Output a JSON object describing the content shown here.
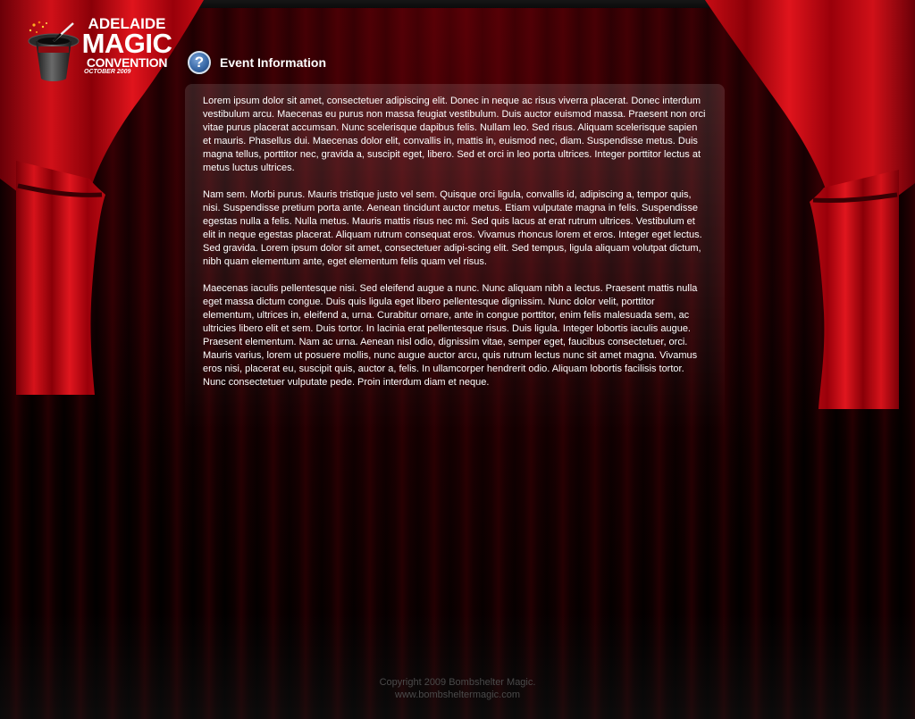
{
  "logo": {
    "line1": "ADELAIDE",
    "line2": "MAGIC",
    "line3": "CONVENTION",
    "line4": "OCTOBER 2009"
  },
  "heading": {
    "icon": "help-icon",
    "icon_glyph": "?",
    "title": "Event Information"
  },
  "content": {
    "paragraphs": [
      "Lorem ipsum dolor sit amet, consectetuer adipiscing elit. Donec in neque ac risus viverra placerat. Donec interdum vestibulum arcu. Maecenas eu purus non massa feugiat vestibulum. Duis auctor euismod massa. Praesent non orci vitae purus placerat accumsan. Nunc scelerisque dapibus felis. Nullam leo. Sed risus. Aliquam scelerisque sapien et mauris. Phasellus dui. Maecenas dolor elit, convallis in, mattis in, euismod nec, diam. Suspendisse metus. Duis magna tellus, porttitor nec, gravida a, suscipit eget, libero. Sed et orci in leo porta ultrices. Integer porttitor lectus at metus luctus ultrices.",
      "Nam sem. Morbi purus. Mauris tristique justo vel sem. Quisque orci ligula, convallis id, adipiscing a, tempor quis, nisi. Suspendisse pretium porta ante. Aenean tincidunt auctor metus. Etiam vulputate magna in felis. Suspendisse egestas nulla a felis. Nulla metus. Mauris mattis risus nec mi. Sed quis lacus at erat rutrum ultrices. Vestibulum et elit in neque egestas placerat. Aliquam rutrum consequat eros. Vivamus rhoncus lorem et eros. Integer eget lectus. Sed gravida. Lorem ipsum dolor sit amet, consectetuer adipi-scing elit. Sed tempus, ligula aliquam volutpat dictum, nibh quam elementum ante, eget elementum felis quam vel risus.",
      "Maecenas iaculis pellentesque nisi. Sed eleifend augue a nunc. Nunc aliquam nibh a lectus. Praesent mattis nulla eget massa dictum congue. Duis quis ligula eget libero pellentesque dignissim. Nunc dolor velit, porttitor elementum, ultrices in, eleifend a, urna. Curabitur ornare, ante in congue porttitor, enim felis malesuada sem, ac ultricies libero elit et sem. Duis tortor. In lacinia erat pellentesque risus. Duis ligula. Integer lobortis iaculis augue. Praesent elementum. Nam ac urna. Aenean nisl odio, dignissim vitae, semper eget, faucibus consectetuer, orci. Mauris varius, lorem ut posuere mollis, nunc augue auctor arcu, quis rutrum lectus nunc sit amet magna. Vivamus eros nisi, placerat eu, suscipit quis, auctor a, felis. In ullamcorper hendrerit odio. Aliquam lobortis facilisis tortor. Nunc consectetuer vulputate pede. Proin interdum diam et neque."
    ]
  },
  "footer": {
    "copyright": "Copyright  2009 Bombshelter Magic.",
    "url": "www.bombsheltermagic.com"
  },
  "colors": {
    "curtain_red": "#c40a12",
    "curtain_dark": "#5a0006",
    "text": "#ffffff",
    "footer_text": "#4a4a4a",
    "icon_blue": "#3a6aa8"
  }
}
